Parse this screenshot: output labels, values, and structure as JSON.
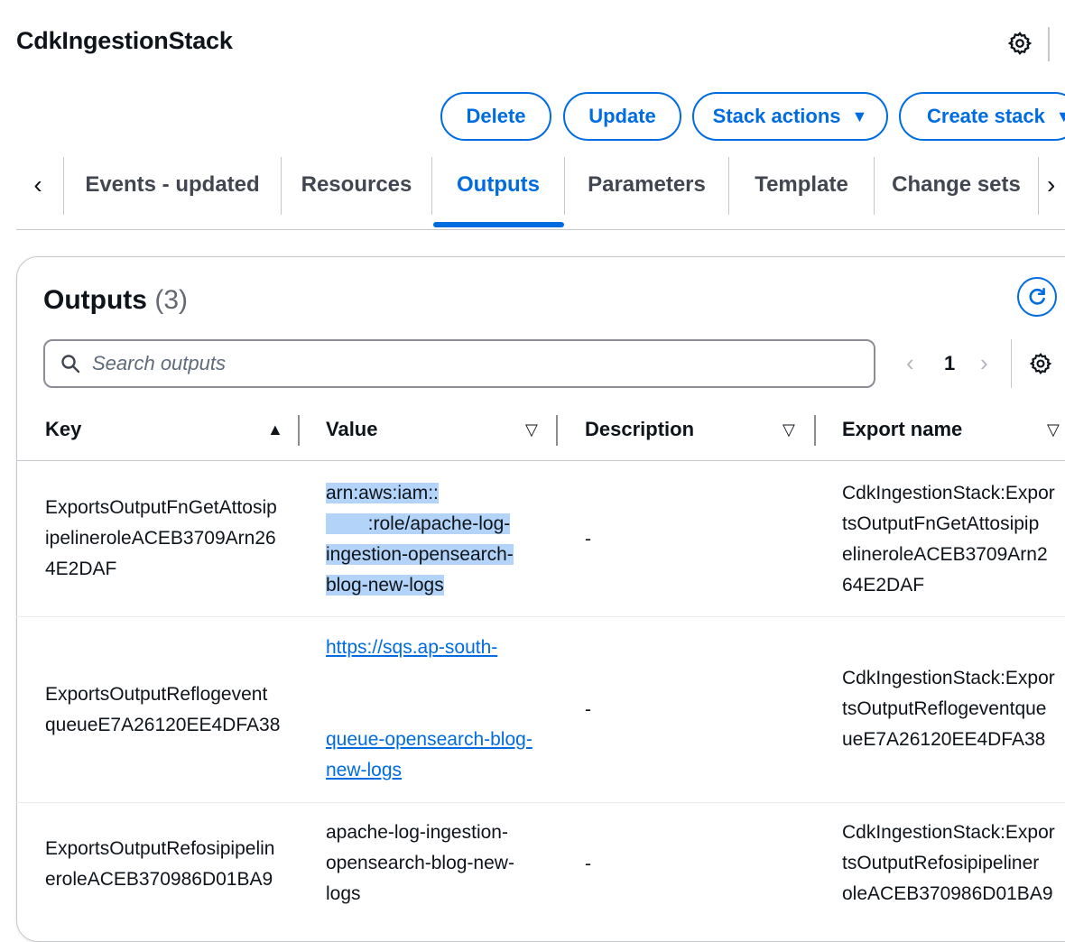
{
  "header": {
    "title": "CdkIngestionStack",
    "settings_icon": "gear-icon"
  },
  "actions": {
    "delete": "Delete",
    "update": "Update",
    "stack_actions": "Stack actions",
    "create_stack": "Create stack",
    "caret": "▼"
  },
  "tabs": {
    "prev": "‹",
    "next": "›",
    "items": [
      "Events - updated",
      "Resources",
      "Outputs",
      "Parameters",
      "Template",
      "Change sets"
    ],
    "active": "Outputs"
  },
  "outputs": {
    "title": "Outputs",
    "count": "(3)",
    "search_placeholder": "Search outputs",
    "search_value": "",
    "pagination": {
      "prev": "‹",
      "page": "1",
      "next": "›"
    }
  },
  "table": {
    "columns": [
      "Key",
      "Value",
      "Description",
      "Export name"
    ],
    "sort_asc": "▲",
    "sort_none": "▽",
    "rows": [
      {
        "key_lines": [
          "ExportsOutputFnGetAttosip",
          "ipelineroleACEB3709Arn26",
          "4E2DAF"
        ],
        "value_lines": [
          "arn:aws:iam::",
          "        :role/apache-log-",
          "ingestion-opensearch-",
          "blog-new-logs"
        ],
        "description": "-",
        "export_lines": [
          "CdkIngestionStack:Expor",
          "tsOutputFnGetAttosipip",
          "elineroleACEB3709Arn2",
          "64E2DAF"
        ]
      },
      {
        "key_lines": [
          "ExportsOutputReflogevent",
          "queueE7A26120EE4DFA38"
        ],
        "value_lines": [
          "https://sqs.ap-south-",
          "",
          "",
          "queue-opensearch-blog-",
          "new-logs"
        ],
        "description": "-",
        "export_lines": [
          "CdkIngestionStack:Expor",
          "tsOutputReflogeventque",
          "ueE7A26120EE4DFA38"
        ]
      },
      {
        "key_lines": [
          "ExportsOutputRefosipipelin",
          "eroleACEB370986D01BA9"
        ],
        "value_lines": [
          "apache-log-ingestion-",
          "opensearch-blog-new-",
          "logs"
        ],
        "description": "-",
        "export_lines": [
          "CdkIngestionStack:Expor",
          "tsOutputRefosipipeliner",
          "oleACEB370986D01BA9"
        ]
      }
    ]
  },
  "colors": {
    "accent": "#006ce0",
    "highlight": "#b4d3f8",
    "text": "#0f141a"
  }
}
